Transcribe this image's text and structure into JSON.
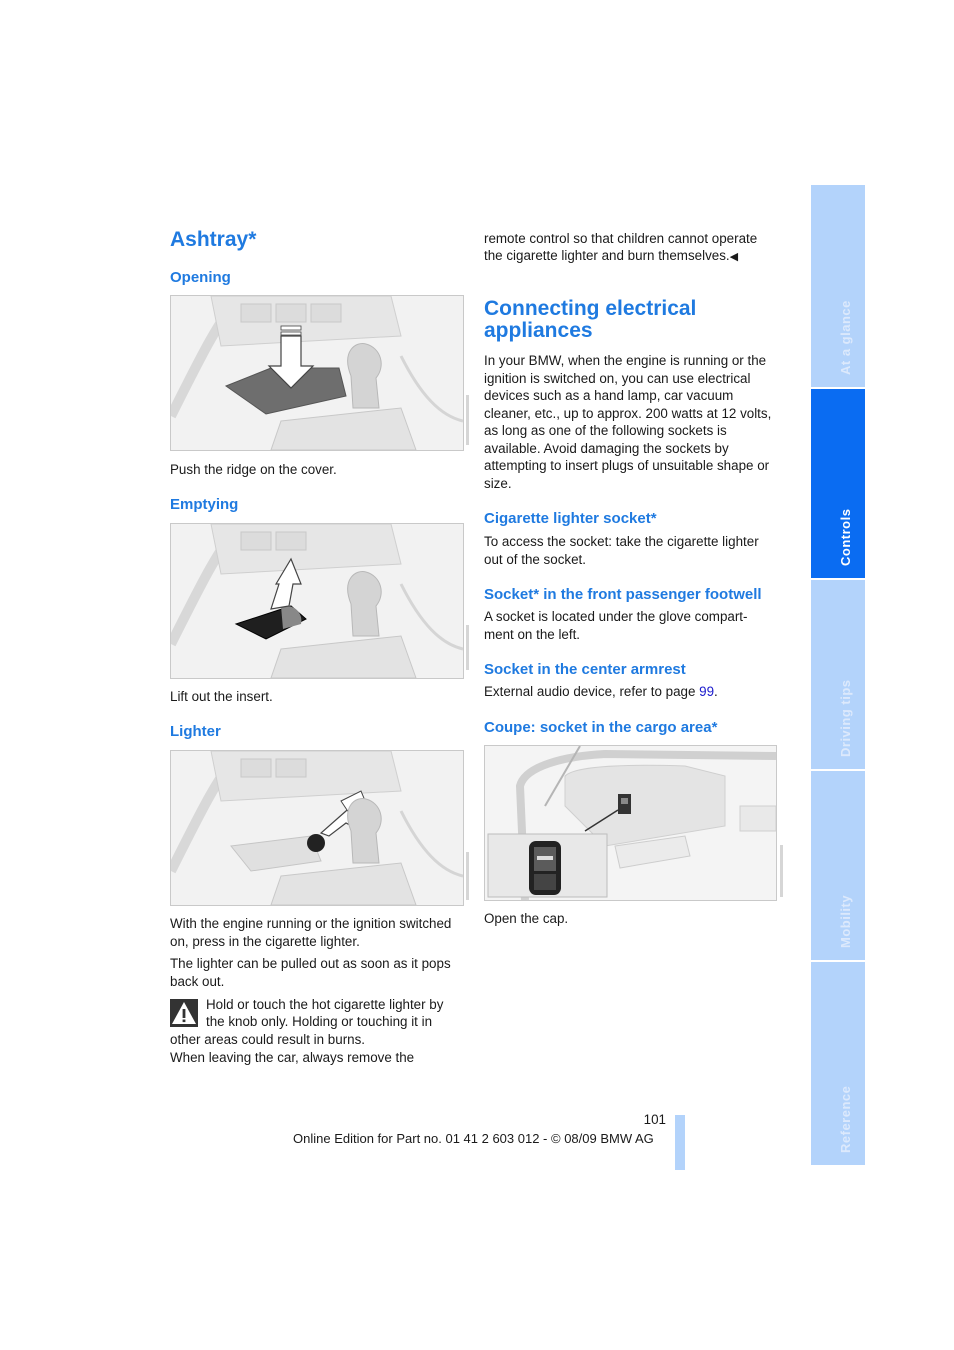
{
  "left_column": {
    "title": "Ashtray*",
    "sections": [
      {
        "heading": "Opening",
        "caption": "Push the ridge on the cover.",
        "figure": "ashtray-cover-push-illustration"
      },
      {
        "heading": "Emptying",
        "caption": "Lift out the insert.",
        "figure": "ashtray-insert-lift-illustration"
      },
      {
        "heading": "Lighter",
        "figure": "cigarette-lighter-press-illustration",
        "paragraphs": [
          "With the engine running or the ignition switched on, press in the cigarette lighter.",
          "The lighter can be pulled out as soon as it pops back out."
        ],
        "warning": {
          "line1": "Hold or touch the hot cigarette lighter by",
          "line2": "the knob only. Holding or touching it in",
          "line3": "other areas could result in burns.",
          "line4": "When leaving the car, always remove the"
        }
      }
    ]
  },
  "right_column": {
    "continued_text_line1": "remote control so that children cannot operate",
    "continued_text_line2": "the cigarette lighter and burn themselves.",
    "end_mark": "◀",
    "title_line1": "Connecting electrical",
    "title_line2": "appliances",
    "intro": "In your BMW, when the engine is running or the ignition is switched on, you can use electrical devices such as a hand lamp, car vacuum cleaner, etc., up to approx. 200 watts at 12 volts, as long as one of the following sockets is available. Avoid damaging the sockets by attempting to insert plugs of unsuitable shape or size.",
    "sections": [
      {
        "heading": "Cigarette lighter socket*",
        "text": "To access the socket: take the cigarette lighter out of the socket."
      },
      {
        "heading": "Socket* in the front passenger footwell",
        "text": "A socket is located under the glove compart-ment on the left."
      },
      {
        "heading": "Socket in the center armrest",
        "text_before_link": "External audio device, refer to page ",
        "link": "99",
        "text_after_link": "."
      },
      {
        "heading": "Coupe: socket in the cargo area*",
        "caption": "Open the cap.",
        "figure": "cargo-area-socket-illustration"
      }
    ]
  },
  "side_tabs": [
    {
      "label": "At a glance",
      "active": false
    },
    {
      "label": "Controls",
      "active": true
    },
    {
      "label": "Driving tips",
      "active": false
    },
    {
      "label": "Mobility",
      "active": false
    },
    {
      "label": "Reference",
      "active": false
    }
  ],
  "footer": {
    "page_number": "101",
    "edition": "Online Edition for Part no. 01 41 2 603 012 - © 08/09 BMW AG"
  },
  "colors": {
    "heading_blue": "#1f7ae0",
    "tab_active": "#0a6cf2",
    "tab_inactive": "#b3d3fb",
    "link": "#1a1acc"
  }
}
